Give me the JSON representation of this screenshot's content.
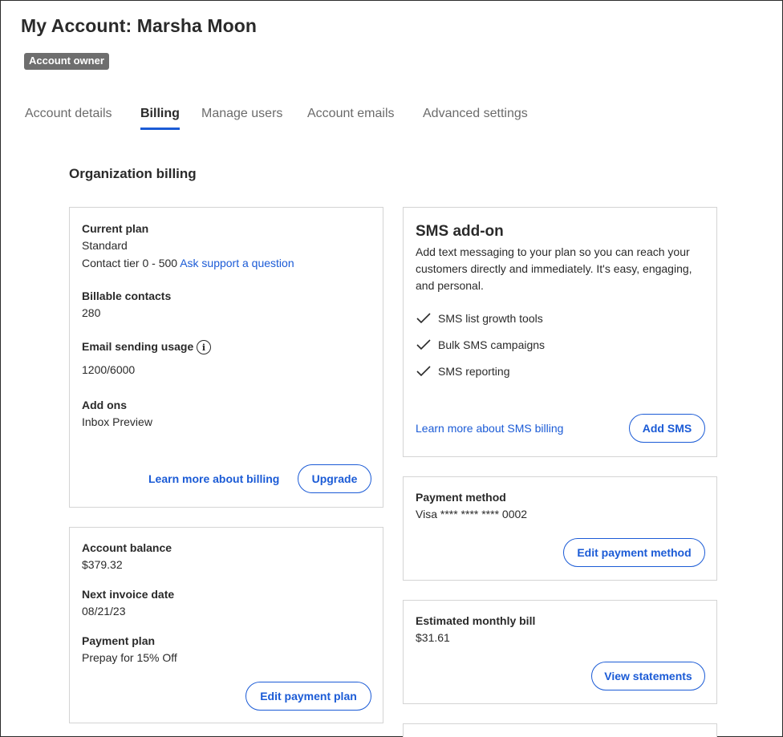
{
  "header": {
    "title": "My Account: Marsha Moon",
    "badge": "Account owner"
  },
  "tabs": [
    {
      "label": "Account details",
      "active": false
    },
    {
      "label": "Billing",
      "active": true
    },
    {
      "label": "Manage users",
      "active": false
    },
    {
      "label": "Account emails",
      "active": false
    },
    {
      "label": "Advanced settings",
      "active": false
    }
  ],
  "section_title": "Organization billing",
  "plan_card": {
    "current_plan_label": "Current plan",
    "current_plan_value": "Standard",
    "contact_tier_text": "Contact tier 0 - 500",
    "support_link": "Ask support a question",
    "billable_contacts_label": "Billable contacts",
    "billable_contacts_value": "280",
    "email_usage_label": "Email sending usage",
    "email_usage_value": "1200/6000",
    "add_ons_label": "Add ons",
    "add_ons_value": "Inbox Preview",
    "learn_more_link": "Learn more about billing",
    "upgrade_button": "Upgrade"
  },
  "balance_card": {
    "balance_label": "Account balance",
    "balance_value": "$379.32",
    "invoice_label": "Next invoice date",
    "invoice_value": "08/21/23",
    "payment_plan_label": "Payment plan",
    "payment_plan_value": "Prepay for 15% Off",
    "edit_plan_button": "Edit payment plan"
  },
  "sms_card": {
    "title": "SMS add-on",
    "description": "Add text messaging to your plan so you can reach your customers directly and immediately. It's easy, engaging, and personal.",
    "features": [
      "SMS list growth tools",
      "Bulk SMS campaigns",
      "SMS reporting"
    ],
    "learn_more_link": "Learn more about SMS billing",
    "add_button": "Add SMS"
  },
  "payment_card": {
    "label": "Payment method",
    "value": "Visa **** **** **** 0002",
    "edit_button": "Edit payment method"
  },
  "bill_card": {
    "label": "Estimated monthly bill",
    "value": "$31.61",
    "statements_button": "View statements"
  },
  "colors": {
    "accent": "#1b5bd6",
    "badge_bg": "#6e6e6e",
    "text": "#2a2a2a",
    "muted": "#6b6b6b",
    "border": "#d4d4d4"
  }
}
